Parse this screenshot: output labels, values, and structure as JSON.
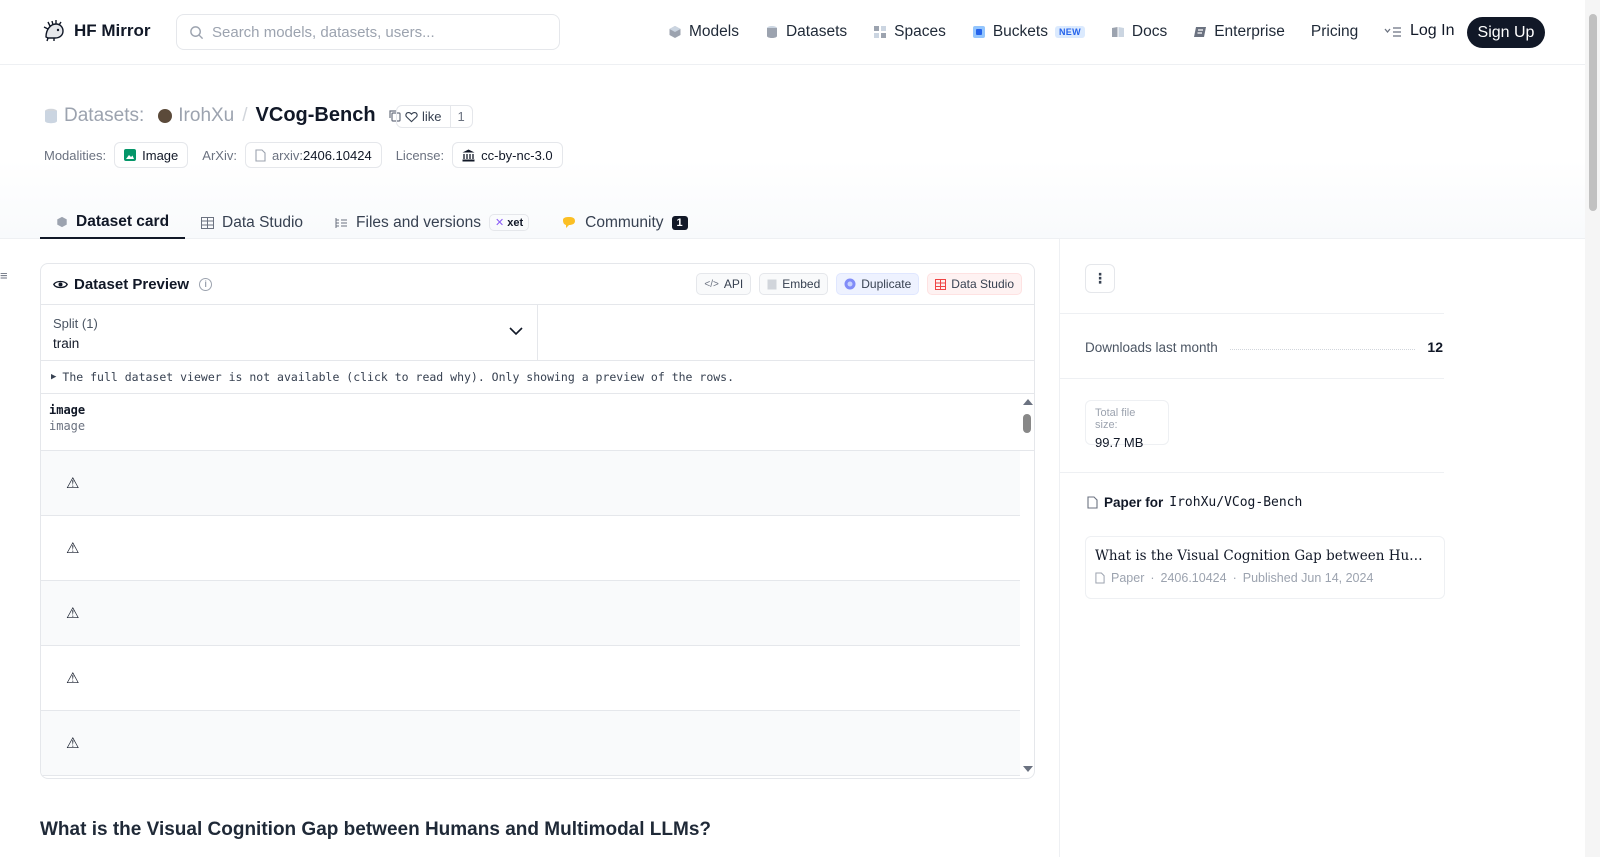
{
  "header": {
    "brand": "HF Mirror",
    "search_placeholder": "Search models, datasets, users...",
    "nav": [
      {
        "label": "Models",
        "icon": "cube-icon"
      },
      {
        "label": "Datasets",
        "icon": "database-icon"
      },
      {
        "label": "Spaces",
        "icon": "grid-icon"
      },
      {
        "label": "Buckets",
        "icon": "bucket-icon",
        "badge": "NEW"
      },
      {
        "label": "Docs",
        "icon": "book-icon"
      },
      {
        "label": "Enterprise",
        "icon": "enterprise-icon"
      },
      {
        "label": "Pricing"
      }
    ],
    "login": "Log In",
    "signup": "Sign Up"
  },
  "repo": {
    "type_label": "Datasets:",
    "owner": "IrohXu",
    "name": "VCog-Bench",
    "like_label": "like",
    "like_count": "1",
    "modalities_label": "Modalities:",
    "modality": "Image",
    "arxiv_label": "ArXiv:",
    "arxiv_prefix": "arxiv:",
    "arxiv_id": "2406.10424",
    "license_label": "License:",
    "license": "cc-by-nc-3.0"
  },
  "tabs": {
    "dataset_card": "Dataset card",
    "data_studio": "Data Studio",
    "files": "Files and versions",
    "xet": "xet",
    "community": "Community",
    "community_count": "1"
  },
  "preview": {
    "title": "Dataset Preview",
    "api": "API",
    "embed": "Embed",
    "duplicate": "Duplicate",
    "data_studio": "Data Studio",
    "split_label": "Split (1)",
    "split_value": "train",
    "notice": "The full dataset viewer is not available (click to read why). Only showing a preview of the rows.",
    "column_name": "image",
    "column_type": "image",
    "rows": [
      "⚠",
      "⚠",
      "⚠",
      "⚠",
      "⚠"
    ]
  },
  "readme_heading": "What is the Visual Cognition Gap between Humans and Multimodal LLMs?",
  "sidebar": {
    "downloads_label": "Downloads last month",
    "downloads_value": "12",
    "file_size_label": "Total file size:",
    "file_size_value": "99.7 MB",
    "paper_for_label": "Paper for",
    "paper_for_repo": "IrohXu/VCog-Bench",
    "paper_title": "What is the Visual Cognition Gap between Humans and Multimodal LLMs?",
    "paper_kind": "Paper",
    "paper_id": "2406.10424",
    "paper_published": "Published Jun 14, 2024"
  },
  "colors": {
    "dark": "#111827",
    "muted": "#6b7280",
    "border": "#e5e7eb",
    "new_badge": "#2563eb"
  }
}
